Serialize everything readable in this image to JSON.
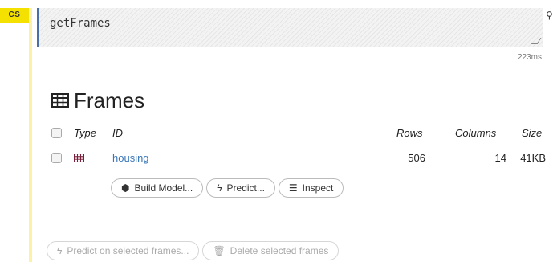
{
  "cell": {
    "badge": "CS",
    "input": "getFrames",
    "timing": "223ms"
  },
  "frames": {
    "title": "Frames",
    "columns": {
      "type": "Type",
      "id": "ID",
      "rows": "Rows",
      "columns": "Columns",
      "size": "Size"
    },
    "rows": [
      {
        "id": "housing",
        "rows": "506",
        "columns": "14",
        "size": "41KB"
      }
    ],
    "actions": {
      "build_model": "Build Model...",
      "predict": "Predict...",
      "inspect": "Inspect"
    },
    "bottom_actions": {
      "predict_selected": "Predict on selected frames...",
      "delete_selected": "Delete selected frames"
    }
  },
  "icons": {
    "table_icon": "table-grid-icon",
    "frame_type_icon": "frame-table-icon",
    "build_model_icon": "cube-icon",
    "predict_icon": "bolt-icon",
    "inspect_icon": "list-icon",
    "delete_icon": "trash-icon",
    "cell_tool_icon": "pin-icon"
  },
  "colors": {
    "badge": "#f5e100",
    "link": "#3a77b8",
    "frame_icon": "#7a1f3a",
    "editor_border": "#4a6fa5"
  }
}
